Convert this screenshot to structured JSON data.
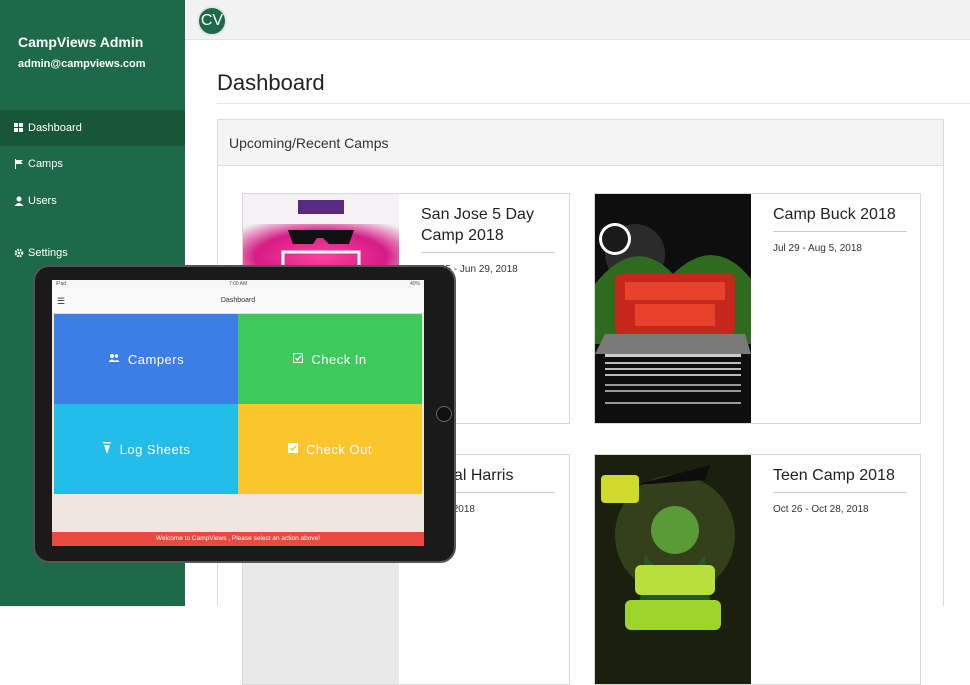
{
  "sidebar": {
    "brand": "CampViews Admin",
    "email": "admin@campviews.com",
    "items": [
      {
        "label": "Dashboard",
        "icon": "grid-icon"
      },
      {
        "label": "Camps",
        "icon": "flag-icon"
      },
      {
        "label": "Users",
        "icon": "user-icon"
      },
      {
        "label": "Settings",
        "icon": "gear-icon"
      }
    ]
  },
  "header": {
    "logo": "CV"
  },
  "main": {
    "title": "Dashboard",
    "panel_title": "Upcoming/Recent Camps",
    "camps": [
      {
        "name": "San Jose 5 Day Camp 2018",
        "dates": "Jun 25 - Jun 29, 2018"
      },
      {
        "name": "Camp Buck 2018",
        "dates": "Jul 29 - Aug 5, 2018"
      },
      {
        "name": "p Seal Harris",
        "dates": "Aug 7, 2018"
      },
      {
        "name": "Teen Camp 2018",
        "dates": "Oct 26 - Oct 28, 2018"
      }
    ]
  },
  "tablet": {
    "status_left": "iPad",
    "status_time": "7:00 AM",
    "status_right": "40%",
    "title": "Dashboard",
    "tiles": [
      {
        "label": "Campers",
        "color": "#3b7ee6"
      },
      {
        "label": "Check In",
        "color": "#3ec95c"
      },
      {
        "label": "Log Sheets",
        "color": "#23bde9"
      },
      {
        "label": "Check Out",
        "color": "#fbc62c"
      }
    ],
    "welcome": "Welcome to CampViews , Please select an action above!"
  },
  "colors": {
    "sidebar": "#1e6a48",
    "sidebar_active": "#175637",
    "accent_red": "#e84a3f"
  }
}
